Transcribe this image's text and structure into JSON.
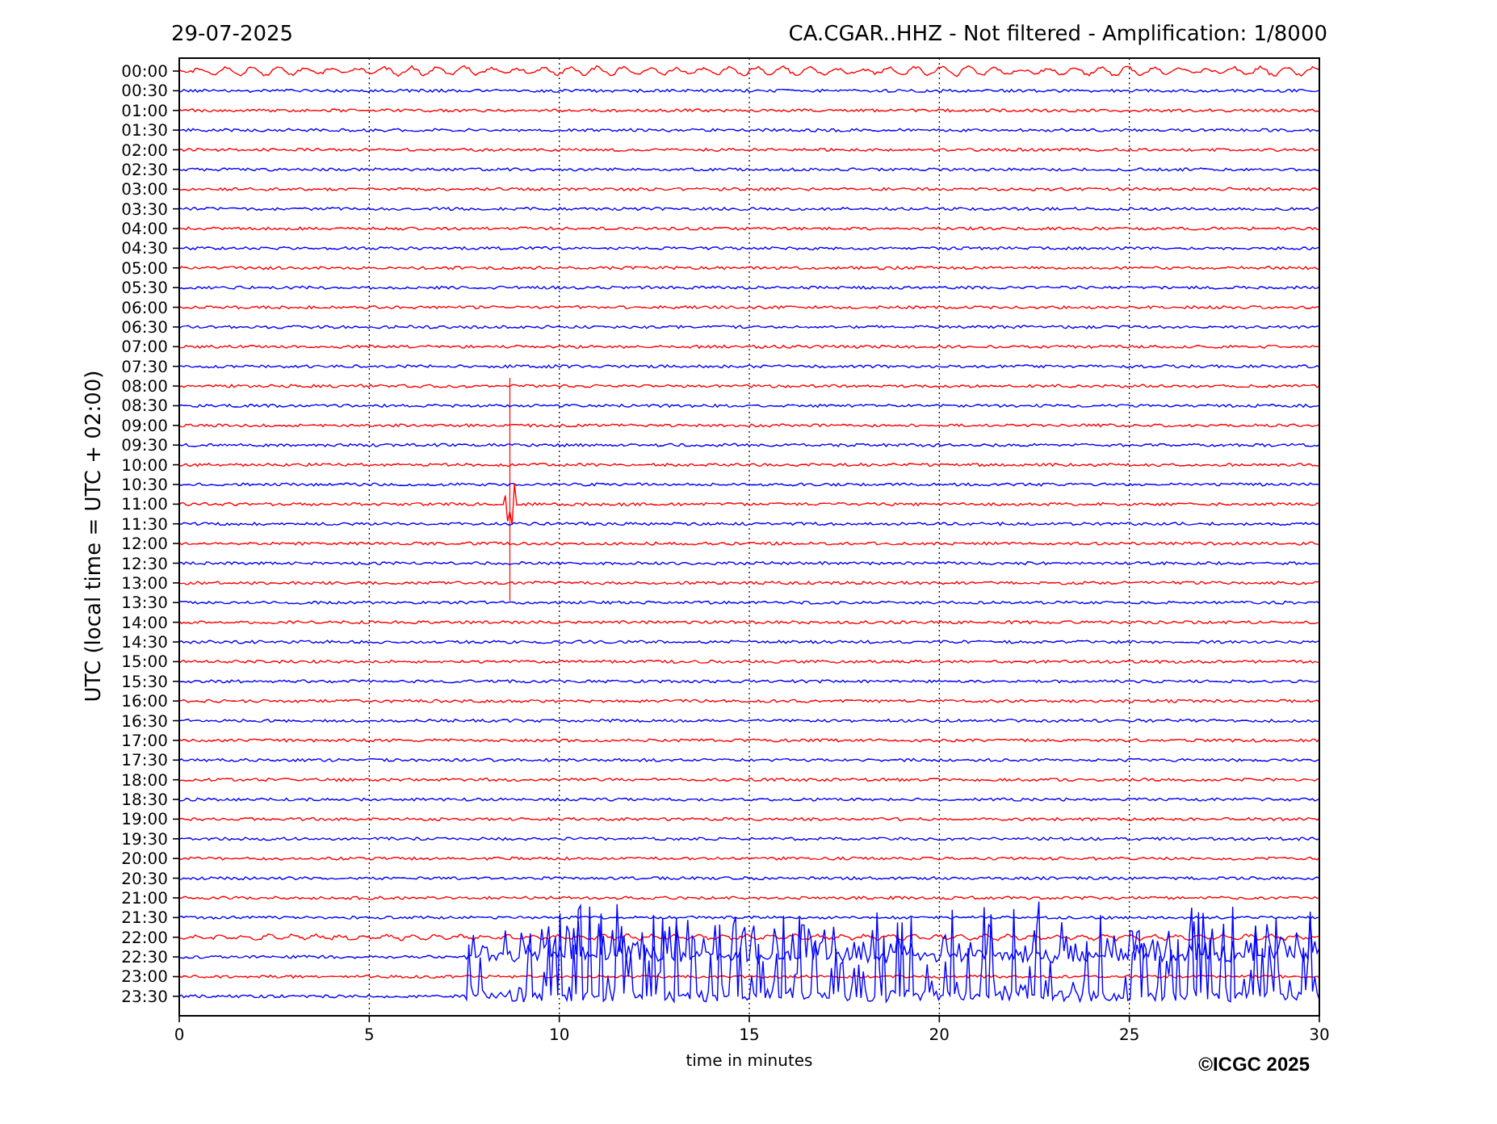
{
  "header": {
    "date": "29-07-2025",
    "title": "CA.CGAR..HHZ - Not filtered - Amplification: 1/8000"
  },
  "plot": {
    "ylabel": "UTC (local time = UTC + 02:00)",
    "xlabel": "time in minutes",
    "xticks": [
      "0",
      "5",
      "10",
      "15",
      "20",
      "25",
      "30"
    ],
    "rows": [
      {
        "label": "00:00",
        "color": "#ff0000"
      },
      {
        "label": "00:30",
        "color": "#0000ff"
      },
      {
        "label": "01:00",
        "color": "#ff0000"
      },
      {
        "label": "01:30",
        "color": "#0000ff"
      },
      {
        "label": "02:00",
        "color": "#ff0000"
      },
      {
        "label": "02:30",
        "color": "#0000ff"
      },
      {
        "label": "03:00",
        "color": "#ff0000"
      },
      {
        "label": "03:30",
        "color": "#0000ff"
      },
      {
        "label": "04:00",
        "color": "#ff0000"
      },
      {
        "label": "04:30",
        "color": "#0000ff"
      },
      {
        "label": "05:00",
        "color": "#ff0000"
      },
      {
        "label": "05:30",
        "color": "#0000ff"
      },
      {
        "label": "06:00",
        "color": "#ff0000"
      },
      {
        "label": "06:30",
        "color": "#0000ff"
      },
      {
        "label": "07:00",
        "color": "#ff0000"
      },
      {
        "label": "07:30",
        "color": "#0000ff"
      },
      {
        "label": "08:00",
        "color": "#ff0000"
      },
      {
        "label": "08:30",
        "color": "#0000ff"
      },
      {
        "label": "09:00",
        "color": "#ff0000"
      },
      {
        "label": "09:30",
        "color": "#0000ff"
      },
      {
        "label": "10:00",
        "color": "#ff0000"
      },
      {
        "label": "10:30",
        "color": "#0000ff"
      },
      {
        "label": "11:00",
        "color": "#ff0000"
      },
      {
        "label": "11:30",
        "color": "#0000ff"
      },
      {
        "label": "12:00",
        "color": "#ff0000"
      },
      {
        "label": "12:30",
        "color": "#0000ff"
      },
      {
        "label": "13:00",
        "color": "#ff0000"
      },
      {
        "label": "13:30",
        "color": "#0000ff"
      },
      {
        "label": "14:00",
        "color": "#ff0000"
      },
      {
        "label": "14:30",
        "color": "#0000ff"
      },
      {
        "label": "15:00",
        "color": "#ff0000"
      },
      {
        "label": "15:30",
        "color": "#0000ff"
      },
      {
        "label": "16:00",
        "color": "#ff0000"
      },
      {
        "label": "16:30",
        "color": "#0000ff"
      },
      {
        "label": "17:00",
        "color": "#ff0000"
      },
      {
        "label": "17:30",
        "color": "#0000ff"
      },
      {
        "label": "18:00",
        "color": "#ff0000"
      },
      {
        "label": "18:30",
        "color": "#0000ff"
      },
      {
        "label": "19:00",
        "color": "#ff0000"
      },
      {
        "label": "19:30",
        "color": "#0000ff"
      },
      {
        "label": "20:00",
        "color": "#ff0000"
      },
      {
        "label": "20:30",
        "color": "#0000ff"
      },
      {
        "label": "21:00",
        "color": "#ff0000"
      },
      {
        "label": "21:30",
        "color": "#0000ff"
      },
      {
        "label": "22:00",
        "color": "#ff0000"
      },
      {
        "label": "22:30",
        "color": "#0000ff"
      },
      {
        "label": "23:00",
        "color": "#ff0000"
      },
      {
        "label": "23:30",
        "color": "#0000ff"
      }
    ]
  },
  "copyright": "©ICGC 2025"
}
